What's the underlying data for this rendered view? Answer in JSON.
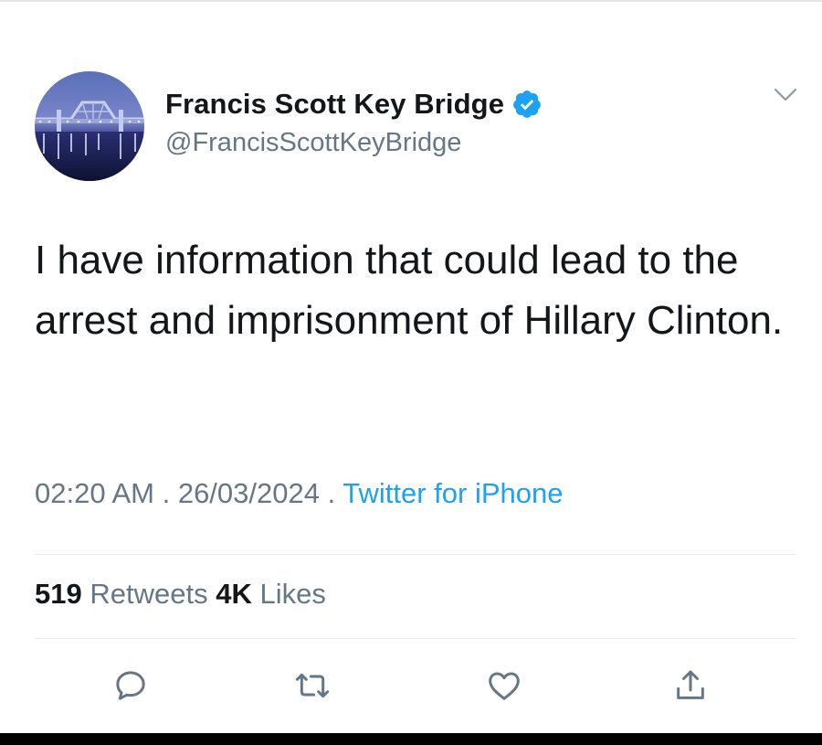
{
  "tweet": {
    "display_name": "Francis Scott Key Bridge",
    "handle": "@FrancisScottKeyBridge",
    "verified": true,
    "text": "I have information that could lead to the arrest and imprisonment of Hillary Clinton.",
    "time": "02:20 AM",
    "date": "26/03/2024",
    "separator": " . ",
    "source": "Twitter for iPhone",
    "retweets_count": "519",
    "retweets_label": "Retweets",
    "likes_count": "4K",
    "likes_label": "Likes"
  },
  "icons": {
    "avatar": "bridge-at-night-photo",
    "verified": "verified-badge-icon",
    "menu": "chevron-down-icon",
    "reply": "reply-icon",
    "retweet": "retweet-icon",
    "like": "heart-icon",
    "share": "share-icon"
  },
  "colors": {
    "text": "#14171a",
    "secondary": "#657786",
    "accent": "#1da1f2",
    "divider": "#e6ecf0"
  }
}
